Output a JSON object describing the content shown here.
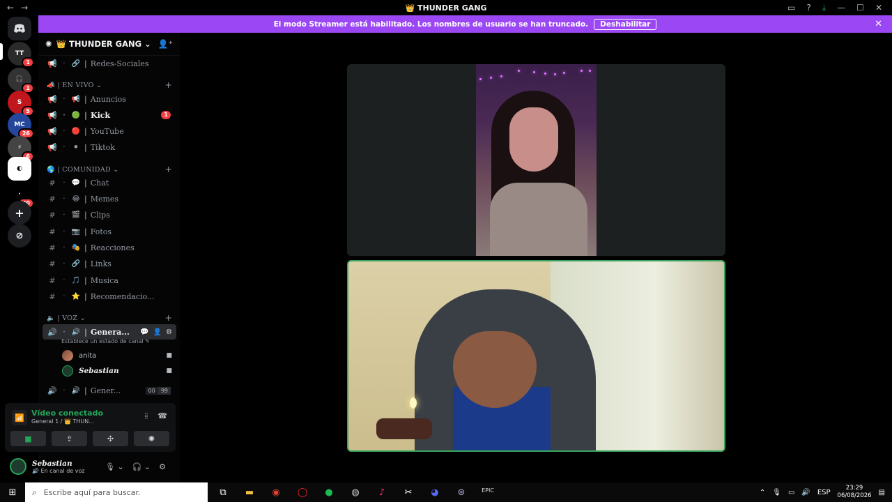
{
  "titlebar": {
    "back": "←",
    "forward": "→",
    "title": "THUNDER GANG",
    "title_icon": "👑",
    "icons": [
      "inbox-icon",
      "help-icon",
      "download-icon",
      "minimize-icon",
      "maximize-icon",
      "close-icon"
    ]
  },
  "banner": {
    "text": "El modo Streamer está habilitado. Los nombres de usuario se han truncado.",
    "button": "Deshabilitar",
    "close": "✕"
  },
  "server_list": {
    "badges": [
      "1",
      "1",
      "5",
      "26",
      "6",
      "40"
    ]
  },
  "server": {
    "name": "THUNDER GANG",
    "crown": "👑"
  },
  "channels": {
    "top": {
      "label": "Redes-Sociales",
      "emoji": "🔗"
    },
    "cat_en_vivo": "EN VIVO",
    "en_vivo": [
      {
        "label": "Anuncios",
        "emoji": "📢"
      },
      {
        "label": "Kick",
        "emoji": "🟢",
        "unread": "1"
      },
      {
        "label": "YouTube",
        "emoji": "🔴"
      },
      {
        "label": "Tiktok",
        "emoji": "⚫"
      }
    ],
    "cat_comunidad": "COMUNIDAD",
    "comunidad": [
      {
        "label": "Chat",
        "emoji": "💬"
      },
      {
        "label": "Memes",
        "emoji": "😂"
      },
      {
        "label": "Clips",
        "emoji": "🎬"
      },
      {
        "label": "Fotos",
        "emoji": "📷"
      },
      {
        "label": "Reacciones",
        "emoji": "🎭"
      },
      {
        "label": "Links",
        "emoji": "🔗"
      },
      {
        "label": "Musica",
        "emoji": "🎵"
      },
      {
        "label": "Recomendacio...",
        "emoji": "⭐"
      }
    ],
    "cat_voz": "VOZ",
    "voice_active": {
      "label": "Genera...",
      "status": "Establece un estado de canal"
    },
    "members": [
      "anita",
      "Sebastian"
    ],
    "voice_other": {
      "label": "Gener...",
      "count_a": "00",
      "count_b": "99"
    }
  },
  "voice_panel": {
    "title": "Vídeo conectado",
    "sub": "General 1 / 👑 THUN..."
  },
  "user": {
    "name": "Sebastian",
    "status": "En canal de voz"
  },
  "taskbar": {
    "search_placeholder": "Escribe aquí para buscar.",
    "lang": "ESP",
    "time": "23:29",
    "date": "06/08/2026"
  },
  "colors": {
    "banner": "#9b48f4",
    "speaking": "#3ba55d",
    "unread": "#f23f43"
  }
}
